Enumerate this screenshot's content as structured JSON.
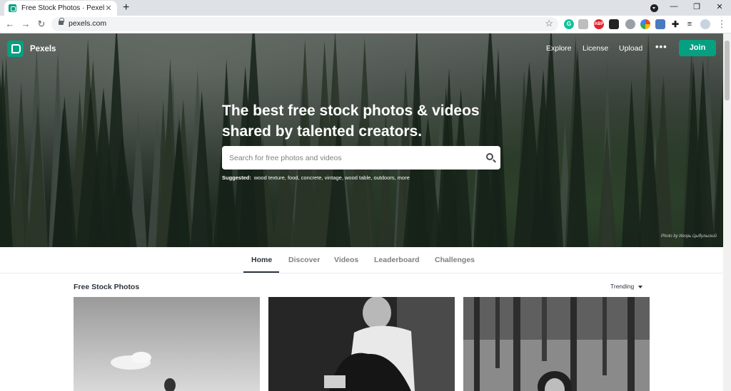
{
  "browser": {
    "tab_title": "Free Stock Photos · Pexels",
    "tab_close": "✕",
    "new_tab": "+",
    "url": "pexels.com",
    "window_controls": [
      "—",
      "❐",
      "✕"
    ],
    "nav": [
      "←",
      "→",
      "↻"
    ],
    "star": "☆",
    "menu": "⋮"
  },
  "site": {
    "brand": "Pexels",
    "nav": [
      "Explore",
      "License",
      "Upload"
    ],
    "more": "•••",
    "join": "Join",
    "headline": "The best free stock photos & videos shared by talented creators.",
    "search_placeholder": "Search for free photos and videos",
    "suggested_label": "Suggested:",
    "suggested_items": "wood texture, food, concrete, vintage, wood table, outdoors, more",
    "photo_credit": "Photo by Игорь Цыбульский",
    "tabs": [
      "Home",
      "Discover",
      "Videos",
      "Leaderboard",
      "Challenges"
    ],
    "section_title": "Free Stock Photos",
    "sort_label": "Trending"
  },
  "colors": {
    "brand": "#05a081",
    "text_dark": "#2c343e"
  },
  "icons": [
    "pexels-logo-icon",
    "search-icon",
    "lock-icon",
    "star-icon",
    "grammarly-icon",
    "abp-icon",
    "puzzle-icon"
  ]
}
